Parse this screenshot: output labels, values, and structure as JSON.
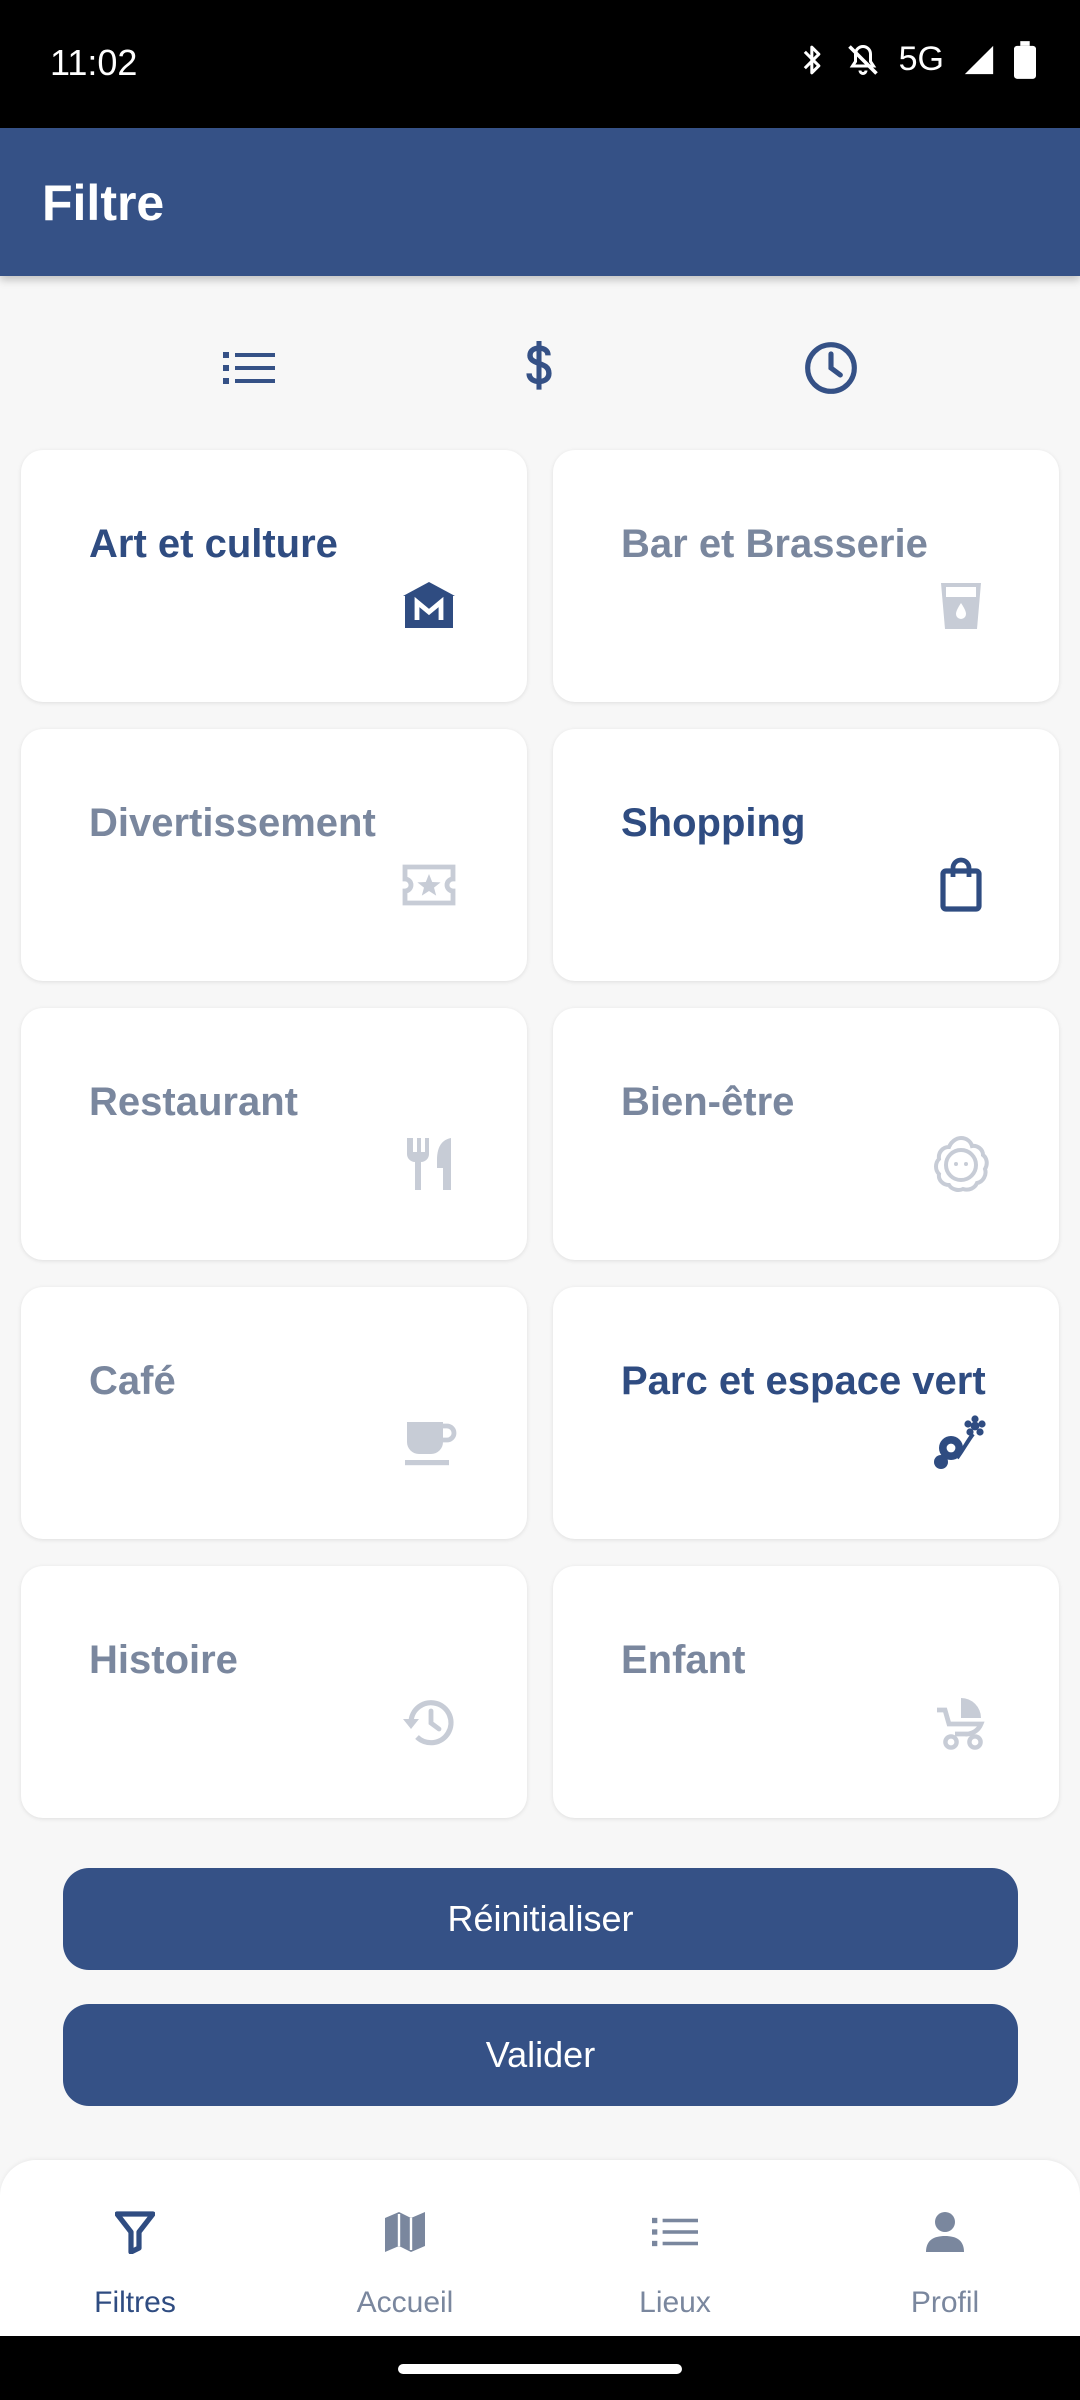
{
  "status_bar": {
    "time": "11:02",
    "network": "5G"
  },
  "app_bar": {
    "title": "Filtre"
  },
  "filter_tabs": [
    {
      "icon": "list-icon"
    },
    {
      "icon": "dollar-icon"
    },
    {
      "icon": "clock-icon"
    }
  ],
  "categories": [
    {
      "label": "Art et culture",
      "icon": "museum-icon",
      "selected": true
    },
    {
      "label": "Bar et Brasserie",
      "icon": "drink-icon",
      "selected": false
    },
    {
      "label": "Divertissement",
      "icon": "ticket-icon",
      "selected": false
    },
    {
      "label": "Shopping",
      "icon": "shopping-bag-icon",
      "selected": true
    },
    {
      "label": "Restaurant",
      "icon": "utensils-icon",
      "selected": false
    },
    {
      "label": "Bien-être",
      "icon": "spa-icon",
      "selected": false
    },
    {
      "label": "Café",
      "icon": "coffee-icon",
      "selected": false
    },
    {
      "label": "Parc et espace vert",
      "icon": "flowers-icon",
      "selected": true
    },
    {
      "label": "Histoire",
      "icon": "history-icon",
      "selected": false
    },
    {
      "label": "Enfant",
      "icon": "stroller-icon",
      "selected": false
    }
  ],
  "buttons": {
    "reset": "Réinitialiser",
    "validate": "Valider"
  },
  "bottom_nav": [
    {
      "label": "Filtres",
      "icon": "filter-icon",
      "active": true
    },
    {
      "label": "Accueil",
      "icon": "map-icon",
      "active": false
    },
    {
      "label": "Lieux",
      "icon": "list-icon",
      "active": false
    },
    {
      "label": "Profil",
      "icon": "person-icon",
      "active": false
    }
  ],
  "colors": {
    "primary": "#355186",
    "active_text": "#2f4c81",
    "inactive_text": "#7a879e",
    "inactive_icon": "#c7ccd6",
    "background": "#f7f7f7"
  }
}
